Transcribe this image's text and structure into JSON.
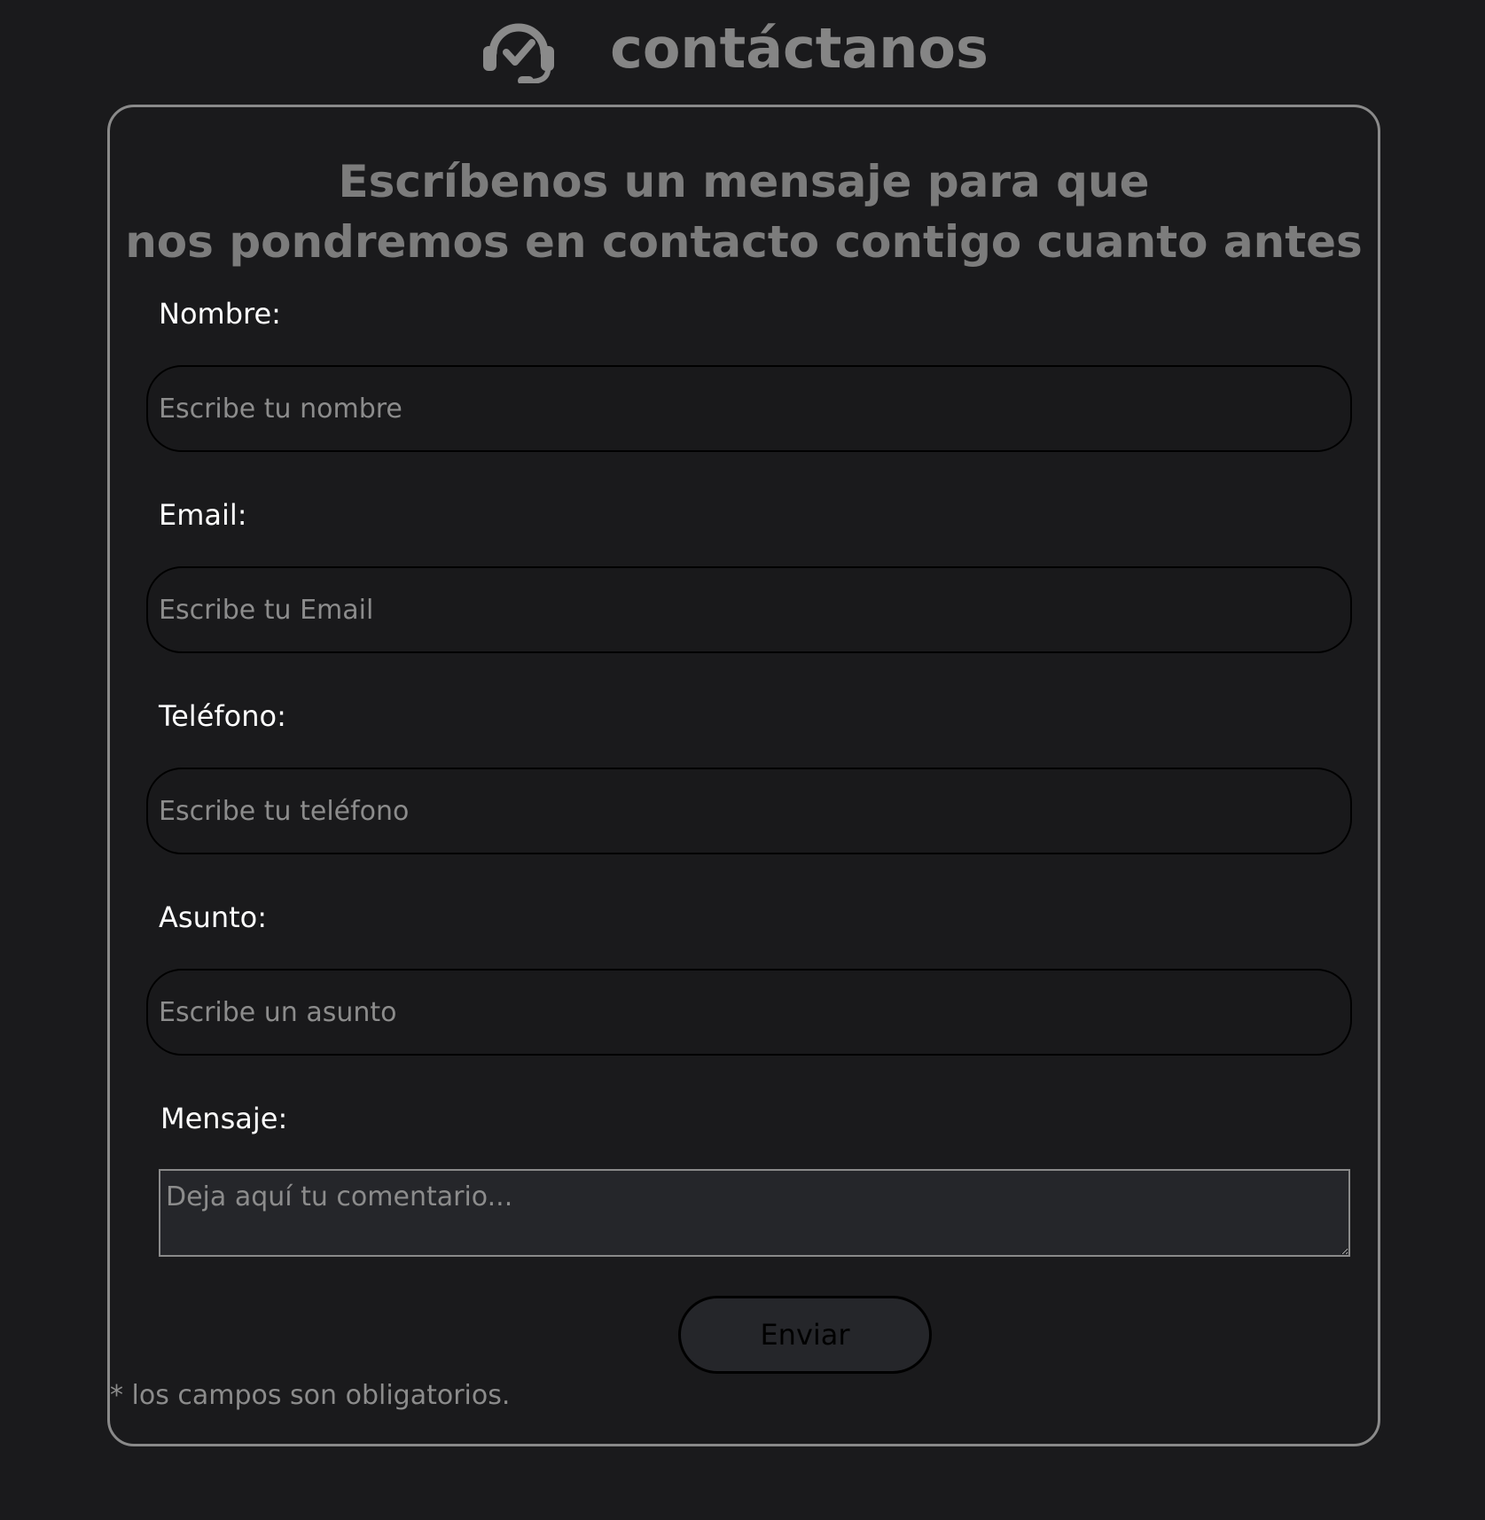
{
  "header": {
    "title": "contáctanos",
    "icon": "headset-check-icon"
  },
  "form": {
    "heading_line1": "Escríbenos un mensaje para que",
    "heading_line2": "nos pondremos en contacto contigo cuanto antes",
    "fields": [
      {
        "label": "Nombre:",
        "placeholder": "Escribe tu nombre",
        "value": ""
      },
      {
        "label": "Email:",
        "placeholder": "Escribe tu Email",
        "value": ""
      },
      {
        "label": "Teléfono:",
        "placeholder": "Escribe tu teléfono",
        "value": ""
      },
      {
        "label": "Asunto:",
        "placeholder": "Escribe un asunto",
        "value": ""
      }
    ],
    "message": {
      "label": "Mensaje:",
      "placeholder": "Deja aquí tu comentario...",
      "value": ""
    },
    "submit_label": "Enviar",
    "required_note": "* los campos son obligatorios."
  },
  "colors": {
    "background": "#1a1a1c",
    "card_border": "#8a8a8a",
    "heading_text": "#7c7c7c",
    "label_text": "#ffffff",
    "placeholder_text": "#8c8c8c",
    "button_background": "#25262a"
  }
}
